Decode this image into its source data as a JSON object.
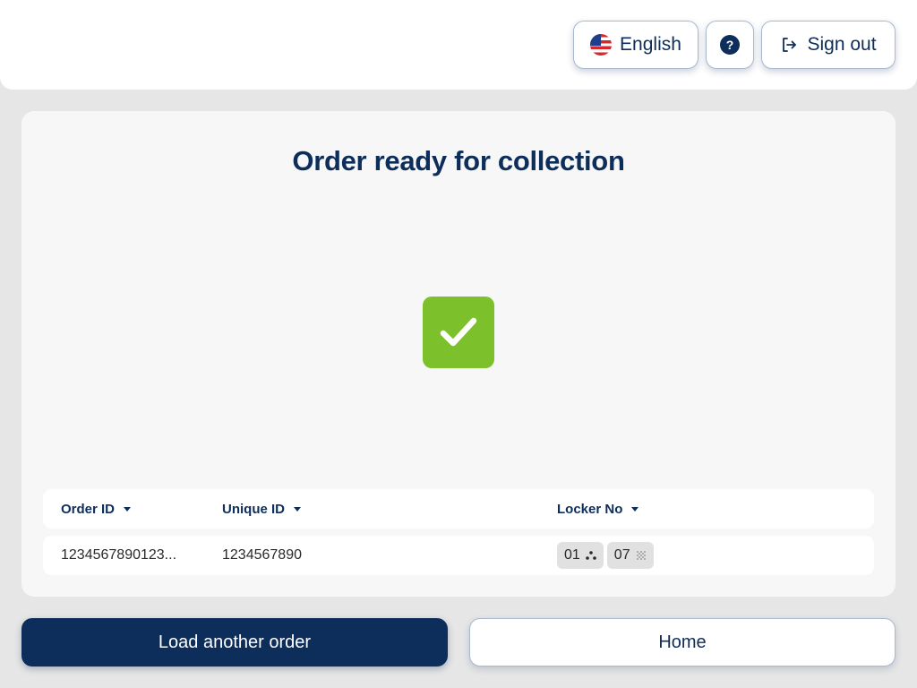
{
  "header": {
    "language_label": "English",
    "help_symbol": "?",
    "signout_label": "Sign out",
    "icons": {
      "language": "us-flag-icon",
      "help": "question-circle-icon",
      "signout": "sign-out-icon"
    }
  },
  "main": {
    "title": "Order ready for collection",
    "status_icon": "checkmark-icon",
    "status_color": "#7cc12c",
    "table": {
      "columns": [
        "Order ID",
        "Unique ID",
        "Locker No"
      ],
      "rows": [
        {
          "order_id": "1234567890123...",
          "unique_id": "1234567890",
          "lockers": [
            "01",
            "07"
          ]
        }
      ]
    }
  },
  "actions": {
    "load_another_label": "Load another order",
    "home_label": "Home"
  },
  "colors": {
    "primary": "#0d2d5a",
    "success": "#7cc12c",
    "background": "#e6e6e6"
  }
}
